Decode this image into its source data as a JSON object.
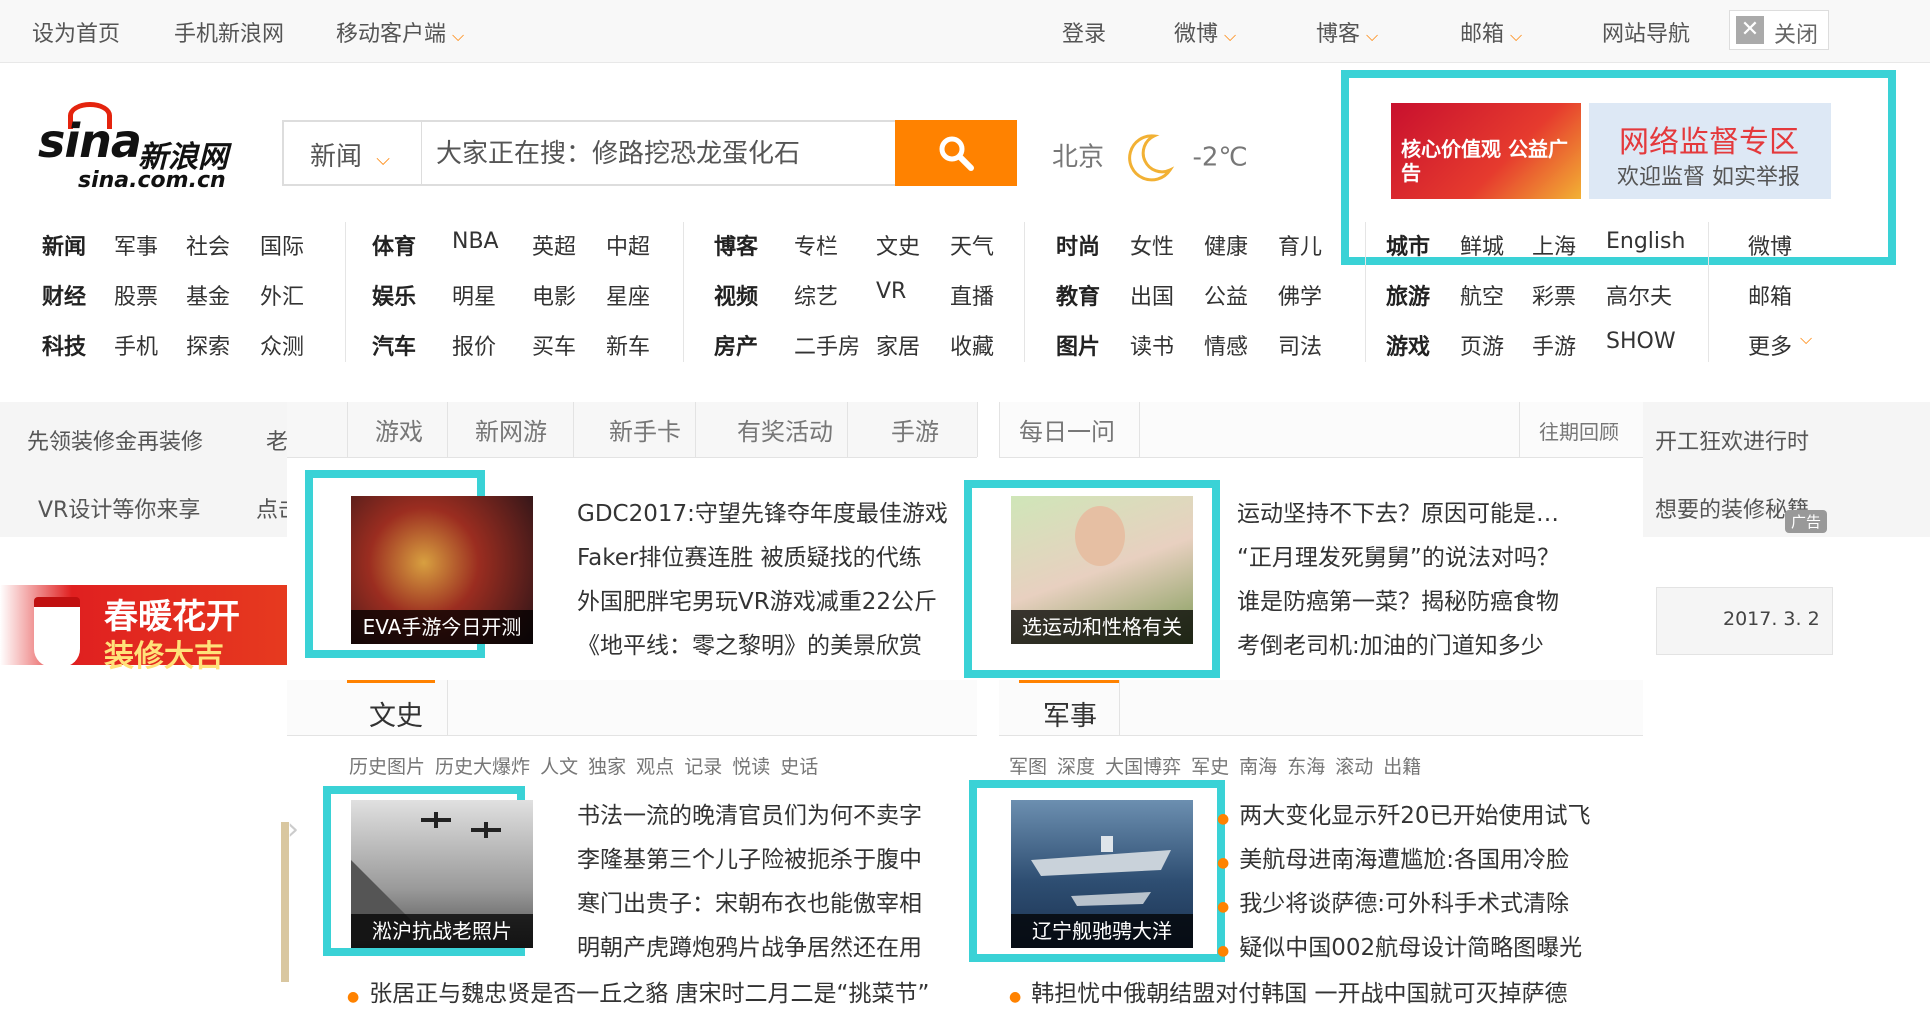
{
  "topbar": {
    "set_home": "设为首页",
    "mobile_sina": "手机新浪网",
    "mobile_client": "移动客户端",
    "login": "登录",
    "weibo": "微博",
    "blog": "博客",
    "mail": "邮箱",
    "site_nav": "网站导航",
    "close": "关闭"
  },
  "logo": {
    "word": "sina",
    "cn": "新浪网",
    "domain": "sina.com.cn"
  },
  "search": {
    "category": "新闻",
    "placeholder": "大家正在搜：修路挖恐龙蛋化石"
  },
  "weather": {
    "city": "北京",
    "temp": "-2℃"
  },
  "ads": {
    "ad1_text": "核心价值观 公益广告",
    "ad2_title": "网络监督专区",
    "ad2_sub": "欢迎监督 如实举报"
  },
  "nav": {
    "rows": [
      [
        "新闻",
        "军事",
        "社会",
        "国际",
        "体育",
        "NBA",
        "英超",
        "中超",
        "博客",
        "专栏",
        "文史",
        "天气",
        "时尚",
        "女性",
        "健康",
        "育儿",
        "城市",
        "鲜城",
        "上海",
        "English",
        "微博"
      ],
      [
        "财经",
        "股票",
        "基金",
        "外汇",
        "娱乐",
        "明星",
        "电影",
        "星座",
        "视频",
        "综艺",
        "VR",
        "直播",
        "教育",
        "出国",
        "公益",
        "佛学",
        "旅游",
        "航空",
        "彩票",
        "高尔夫",
        "邮箱"
      ],
      [
        "科技",
        "手机",
        "探索",
        "众测",
        "汽车",
        "报价",
        "买车",
        "新车",
        "房产",
        "二手房",
        "家居",
        "收藏",
        "图片",
        "读书",
        "情感",
        "司法",
        "游戏",
        "页游",
        "手游",
        "SHOW",
        "更多"
      ]
    ]
  },
  "band": {
    "left1": "先领装修金再装修",
    "left1b": "老",
    "left2": "VR设计等你来享",
    "left2b": "点击",
    "right1": "开工狂欢进行时",
    "right2": "想要的装修秘籍",
    "ad_tag": "广告",
    "date": "2017. 3. 2",
    "banner_text1": "春暖花开",
    "banner_text2": "装修大吉"
  },
  "games": {
    "tabs": [
      "游戏",
      "新网游",
      "新手卡",
      "有奖活动",
      "手游"
    ],
    "pic_caption": "EVA手游今日开测",
    "items": [
      "GDC2017:守望先锋夺年度最佳游戏",
      "Faker排位赛连胜 被质疑找的代练",
      "外国肥胖宅男玩VR游戏减重22公斤",
      "《地平线：零之黎明》的美景欣赏"
    ]
  },
  "daily": {
    "tab": "每日一问",
    "archive": "往期回顾",
    "pic_caption": "选运动和性格有关",
    "items": [
      "运动坚持不下去？原因可能是…",
      "“正月理发死舅舅”的说法对吗？",
      "谁是防癌第一菜？揭秘防癌食物",
      "考倒老司机:加油的门道知多少"
    ]
  },
  "history": {
    "title": "文史",
    "subs": "历史图片 历史大爆炸 人文 独家 观点 记录 悦读 史话",
    "pic_caption": "淞沪抗战老照片",
    "items": [
      "书法一流的晚清官员们为何不卖字",
      "李隆基第三个儿子险被扼杀于腹中",
      "寒门出贵子：宋朝布衣也能傲宰相",
      "明朝产虎蹲炮鸦片战争居然还在用"
    ],
    "bottom": "张居正与魏忠贤是否一丘之貉 唐宋时二月二是“挑菜节”"
  },
  "military": {
    "title": "军事",
    "subs": "军图 深度 大国博弈 军史 南海 东海 滚动 出籍",
    "pic_caption": "辽宁舰驰骋大洋",
    "items": [
      "两大变化显示歼20已开始使用试飞",
      "美航母进南海遭尴尬:各国用冷脸",
      "我少将谈萨德:可外科手术式清除",
      "疑似中国002航母设计简略图曝光"
    ],
    "bottom": "韩担忧中俄朝结盟对付韩国 一开战中国就可灭掉萨德"
  },
  "colors": {
    "accent": "#ff8200",
    "highlight": "#3ad2d6",
    "red": "#e4240e"
  }
}
